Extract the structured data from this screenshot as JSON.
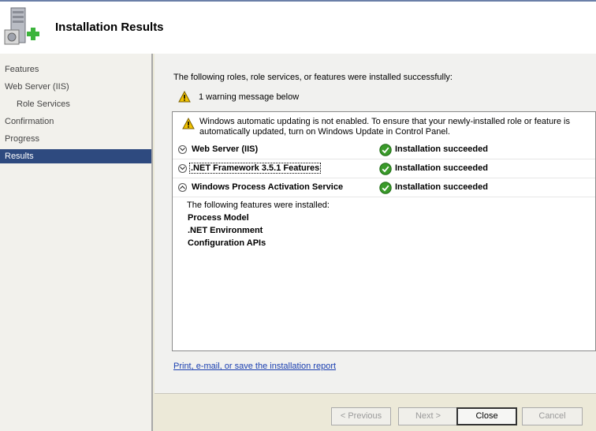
{
  "header": {
    "title": "Installation Results",
    "logo_icon": "server-add-icon"
  },
  "sidebar": {
    "items": [
      {
        "label": "Features"
      },
      {
        "label": "Web Server (IIS)"
      },
      {
        "label": "Role Services"
      },
      {
        "label": "Confirmation"
      },
      {
        "label": "Progress"
      },
      {
        "label": "Results",
        "selected": true
      }
    ]
  },
  "main": {
    "intro": "The following roles, role services, or features were installed successfully:",
    "warning_summary": "1 warning message below",
    "warning_message": "Windows automatic updating is not enabled. To ensure that your newly-installed role or feature is automatically updated, turn on Windows Update in Control Panel.",
    "results": [
      {
        "name": "Web Server (IIS)",
        "status": "Installation succeeded",
        "expanded": false
      },
      {
        "name": ".NET Framework 3.5.1 Features",
        "status": "Installation succeeded",
        "expanded": false
      },
      {
        "name": "Windows Process Activation Service",
        "status": "Installation succeeded",
        "expanded": true
      }
    ],
    "details": {
      "intro": "The following features were installed:",
      "items": [
        "Process Model",
        ".NET Environment",
        "Configuration APIs"
      ]
    },
    "report_link": "Print, e-mail, or save the installation report"
  },
  "footer": {
    "previous": "< Previous",
    "next": "Next >",
    "close": "Close",
    "cancel": "Cancel"
  },
  "colors": {
    "selected_bg": "#2e4a7f",
    "link": "#1a3fb0",
    "success": "#3a9a2a",
    "warning": "#f2c200"
  }
}
